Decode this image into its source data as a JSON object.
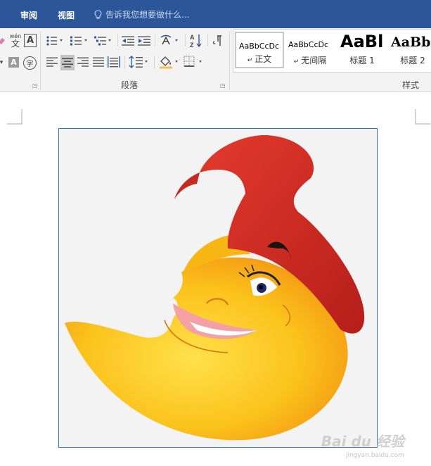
{
  "topbar": {
    "tabs": [
      {
        "label": "审阅"
      },
      {
        "label": "视图"
      }
    ],
    "tellme": {
      "placeholder": "告诉我您想要做什么..."
    }
  },
  "ribbon": {
    "font_group": {
      "pinyin_label": "wén",
      "pinyin_char": "文",
      "char_border": "A",
      "char_shading": "A",
      "enclose_char": "字"
    },
    "paragraph": {
      "label": "段落"
    },
    "styles": {
      "label": "样式",
      "items": [
        {
          "sample": "AaBbCcDc",
          "name": "正文"
        },
        {
          "sample": "AaBbCcDc",
          "name": "无间隔"
        },
        {
          "sample": "AaBl",
          "name": "标题 1"
        },
        {
          "sample": "AaBbC",
          "name": "标题 2"
        }
      ]
    }
  },
  "document": {
    "watermark": "Bai du 经验",
    "watermark_sub": "jingyan.baidu.com"
  },
  "colors": {
    "ribbon_blue": "#2b579a",
    "selection_blue": "#2e75b6"
  }
}
